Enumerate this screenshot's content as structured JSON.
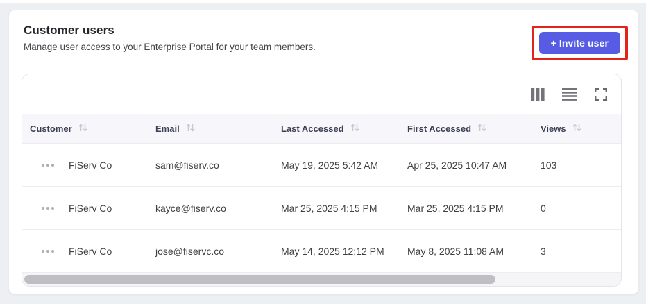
{
  "panel": {
    "title": "Customer users",
    "subtitle": "Manage user access to your Enterprise Portal for your team members.",
    "invite_button": {
      "label": "+ Invite user",
      "color": "#585ce5",
      "highlight_color": "#e3241b"
    }
  },
  "toolbar": {
    "icons": [
      "columns",
      "row-density",
      "fullscreen"
    ]
  },
  "table": {
    "columns": [
      {
        "label": "Customer",
        "sortable": true
      },
      {
        "label": "Email",
        "sortable": true
      },
      {
        "label": "Last Accessed",
        "sortable": true
      },
      {
        "label": "First Accessed",
        "sortable": true
      },
      {
        "label": "Views",
        "sortable": true
      }
    ],
    "rows": [
      {
        "customer": "FiServ Co",
        "email": "sam@fiserv.co",
        "last_accessed": "May 19, 2025 5:42 AM",
        "first_accessed": "Apr 25, 2025 10:47 AM",
        "views": "103"
      },
      {
        "customer": "FiServ Co",
        "email": "kayce@fiserv.co",
        "last_accessed": "Mar 25, 2025 4:15 PM",
        "first_accessed": "Mar 25, 2025 4:15 PM",
        "views": "0"
      },
      {
        "customer": "FiServ Co",
        "email": "jose@fiservc.co",
        "last_accessed": "May 14, 2025 12:12 PM",
        "first_accessed": "May 8, 2025 11:08 AM",
        "views": "3"
      }
    ],
    "scrollbar": {
      "orientation": "horizontal",
      "thumb_fraction": 0.79
    }
  },
  "colors": {
    "page_background": "#edf0f2",
    "header_row_background": "#f7f7fb",
    "accent": "#585ce5",
    "highlight_red": "#e3241b"
  }
}
